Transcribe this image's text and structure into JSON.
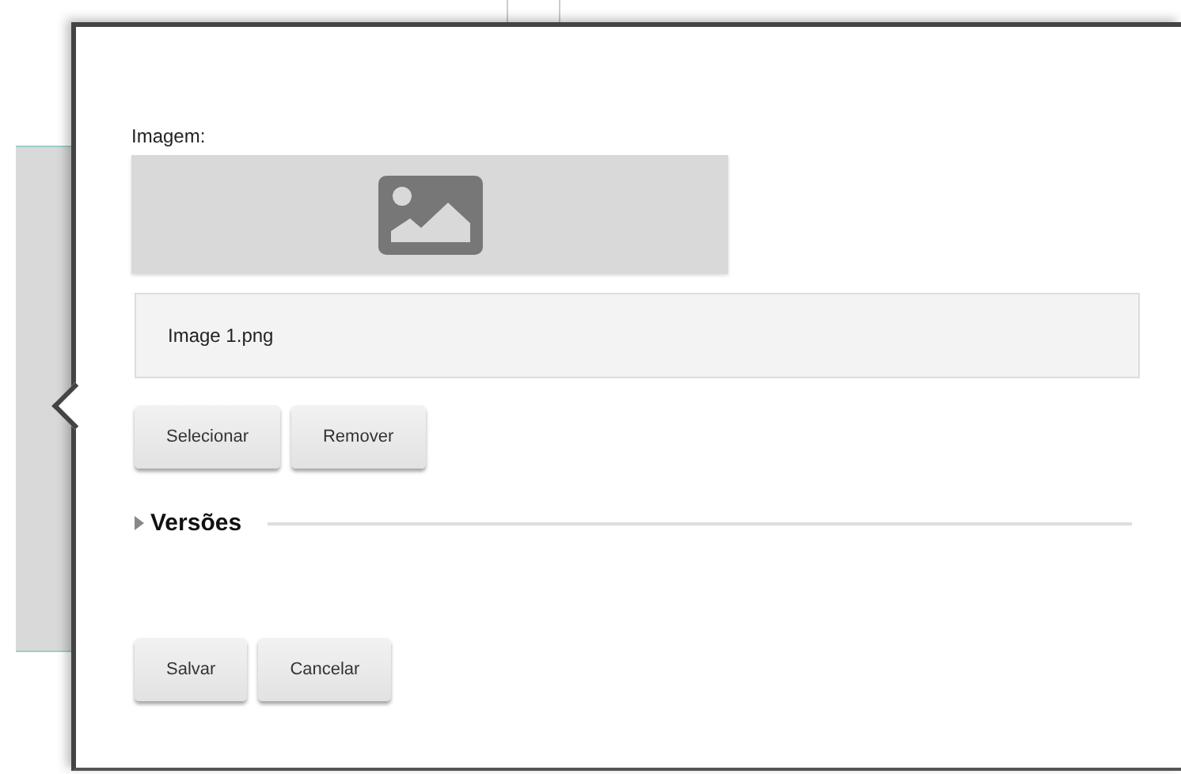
{
  "image_field": {
    "label": "Imagem:",
    "file_name": "Image 1.png"
  },
  "image_buttons": [
    "Selecionar",
    "Remover"
  ],
  "versions": {
    "label": "Versões",
    "expanded": false
  },
  "footer_buttons": [
    "Salvar",
    "Cancelar"
  ]
}
